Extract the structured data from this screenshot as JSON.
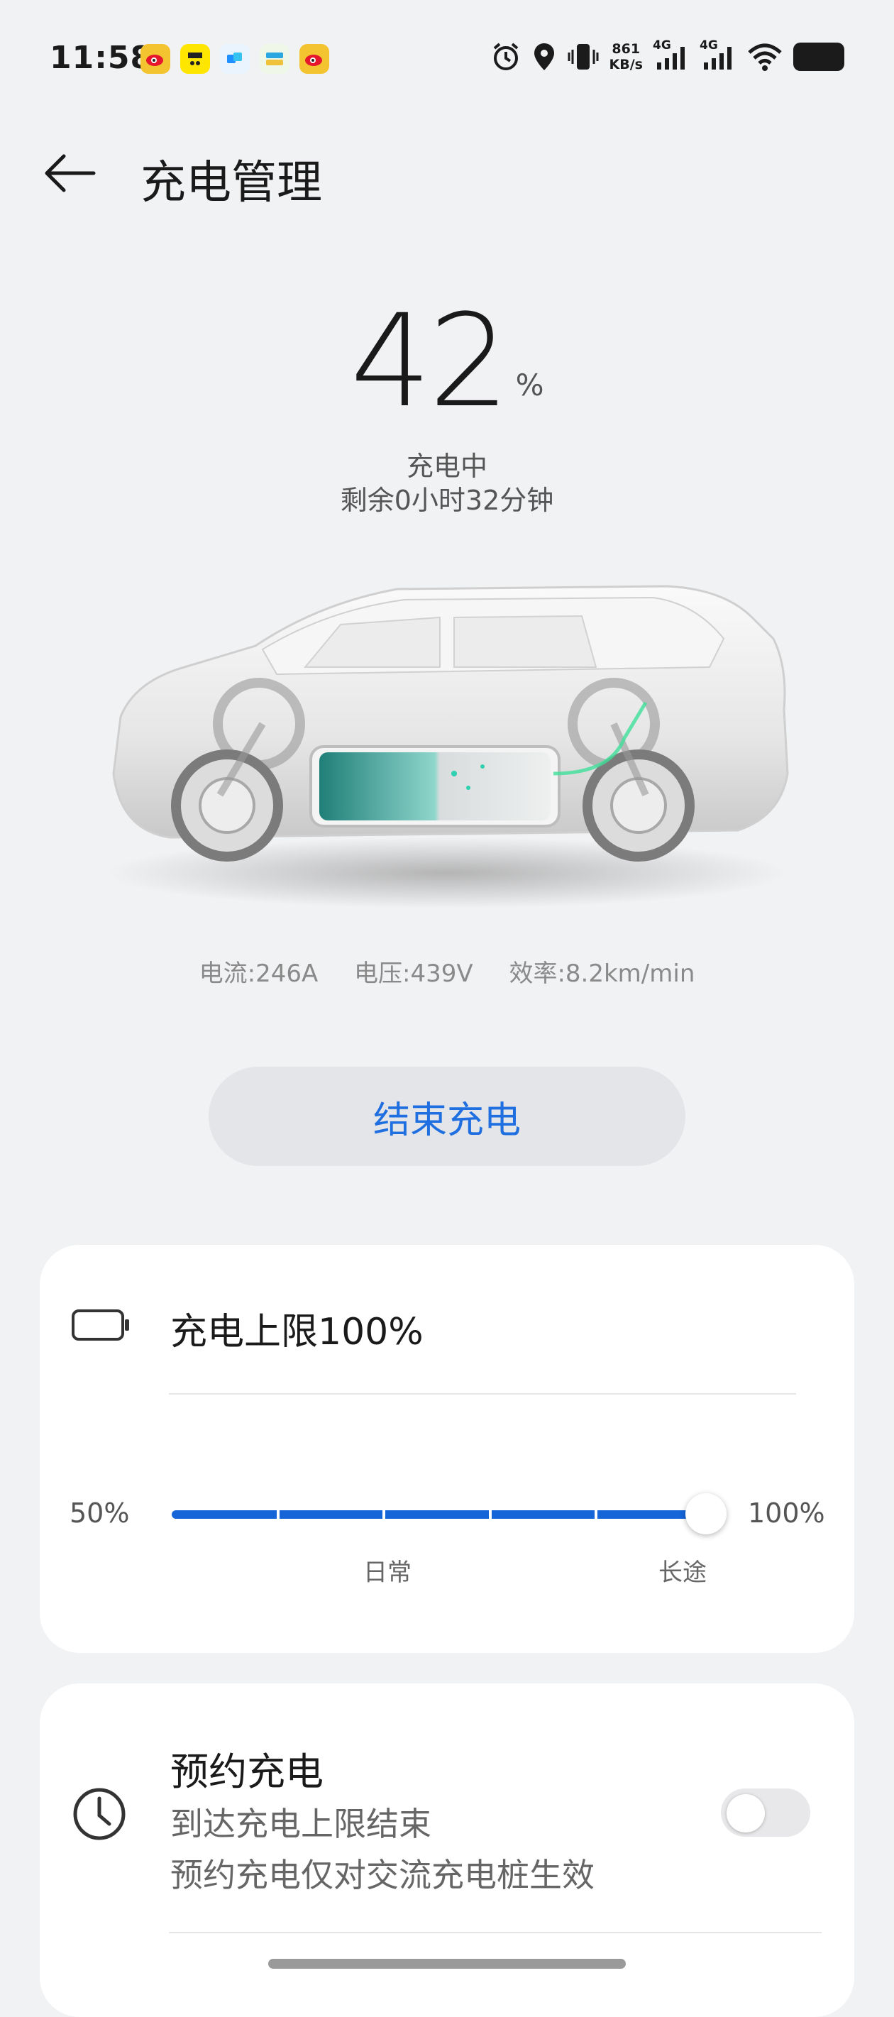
{
  "status_bar": {
    "time": "11:58",
    "net_speed_value": "861",
    "net_speed_unit": "KB/s",
    "signal1": "4G",
    "signal2": "4G",
    "app_icons": [
      "weibo-icon",
      "app-icon",
      "app-icon",
      "app-icon",
      "weibo-icon"
    ]
  },
  "header": {
    "title": "充电管理"
  },
  "charge": {
    "percent": "42",
    "percent_sign": "%",
    "status": "充电中",
    "remaining": "剩余0小时32分钟"
  },
  "metrics": {
    "current": "电流:246A",
    "voltage": "电压:439V",
    "efficiency": "效率:8.2km/min"
  },
  "end_button_label": "结束充电",
  "limit_card": {
    "label": "充电上限100%",
    "min_label": "50%",
    "max_label": "100%",
    "mark_daily": "日常",
    "mark_long": "长途",
    "value_percent": 100
  },
  "schedule_card": {
    "title": "预约充电",
    "subtitle": "到达充电上限结束",
    "note": "预约充电仅对交流充电桩生效",
    "enabled": false
  },
  "colors": {
    "accent": "#1f6fe0",
    "slider": "#1565d8",
    "background": "#f1f2f4"
  }
}
